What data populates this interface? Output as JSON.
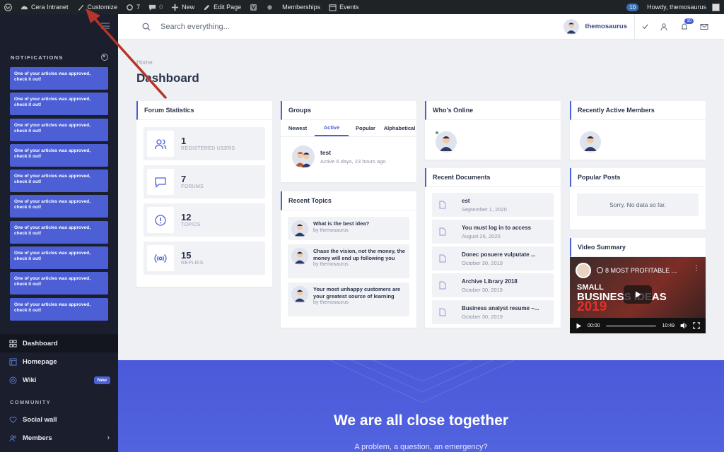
{
  "adminbar": {
    "site_name": "Cera Intranet",
    "customize": "Customize",
    "updates_count": "7",
    "comments_count": "0",
    "new_label": "New",
    "edit_page": "Edit Page",
    "memberships": "Memberships",
    "events": "Events",
    "notif_count": "10",
    "howdy": "Howdy, themosaurus"
  },
  "sidebar": {
    "notifications_title": "NOTIFICATIONS",
    "notification_text": "One of your articles was approved, check it out!",
    "nav": [
      {
        "label": "Dashboard"
      },
      {
        "label": "Homepage"
      },
      {
        "label": "Wiki",
        "badge": "New"
      }
    ],
    "community_title": "COMMUNITY",
    "community": [
      {
        "label": "Social wall"
      },
      {
        "label": "Members"
      }
    ]
  },
  "header": {
    "search_placeholder": "Search everything...",
    "user_name": "themosaurus",
    "notif_badge": "10"
  },
  "main": {
    "breadcrumb": "Home",
    "title": "Dashboard"
  },
  "forum_stats": {
    "title": "Forum Statistics",
    "items": [
      {
        "num": "1",
        "label": "REGISTERED USERS"
      },
      {
        "num": "7",
        "label": "FORUMS"
      },
      {
        "num": "12",
        "label": "TOPICS"
      },
      {
        "num": "15",
        "label": "REPLIES"
      }
    ]
  },
  "groups": {
    "title": "Groups",
    "tabs": [
      "Newest",
      "Active",
      "Popular",
      "Alphabetical"
    ],
    "item": {
      "name": "test",
      "meta": "Active 6 days, 23 hours ago"
    }
  },
  "recent_topics": {
    "title": "Recent Topics",
    "items": [
      {
        "title": "What is the best idea?",
        "by": "by themosaurus"
      },
      {
        "title": "Chase the vision, not the money, the money will end up following you",
        "by": "by themosaurus"
      },
      {
        "title": "Your most unhappy customers are your greatest source of learning",
        "by": "by themosaurus"
      }
    ]
  },
  "whos_online": {
    "title": "Who's Online"
  },
  "recent_documents": {
    "title": "Recent Documents",
    "items": [
      {
        "title": "est",
        "date": "September 1, 2020"
      },
      {
        "title": "You must log in to access",
        "date": "August 26, 2020"
      },
      {
        "title": "Donec posuere vulputate ...",
        "date": "October 30, 2019"
      },
      {
        "title": "Archive Library 2018",
        "date": "October 30, 2019"
      },
      {
        "title": "Business analyst resume –...",
        "date": "October 30, 2019"
      }
    ]
  },
  "recent_members": {
    "title": "Recently Active Members"
  },
  "popular_posts": {
    "title": "Popular Posts",
    "empty": "Sorry. No data so far."
  },
  "video": {
    "title": "Video Summary",
    "video_title": "8 MOST PROFITABLE ...",
    "line1": "SMALL",
    "line2": "BUSINESS IDEAS",
    "line3": "2019",
    "time_current": "00:00",
    "time_total": "10:49"
  },
  "banner": {
    "title": "We are all close together",
    "subtitle": "A problem, a question, an emergency?"
  },
  "colors": {
    "accent": "#4c5fd5",
    "sidebar": "#1b1e2c",
    "admin": "#1d2327"
  }
}
